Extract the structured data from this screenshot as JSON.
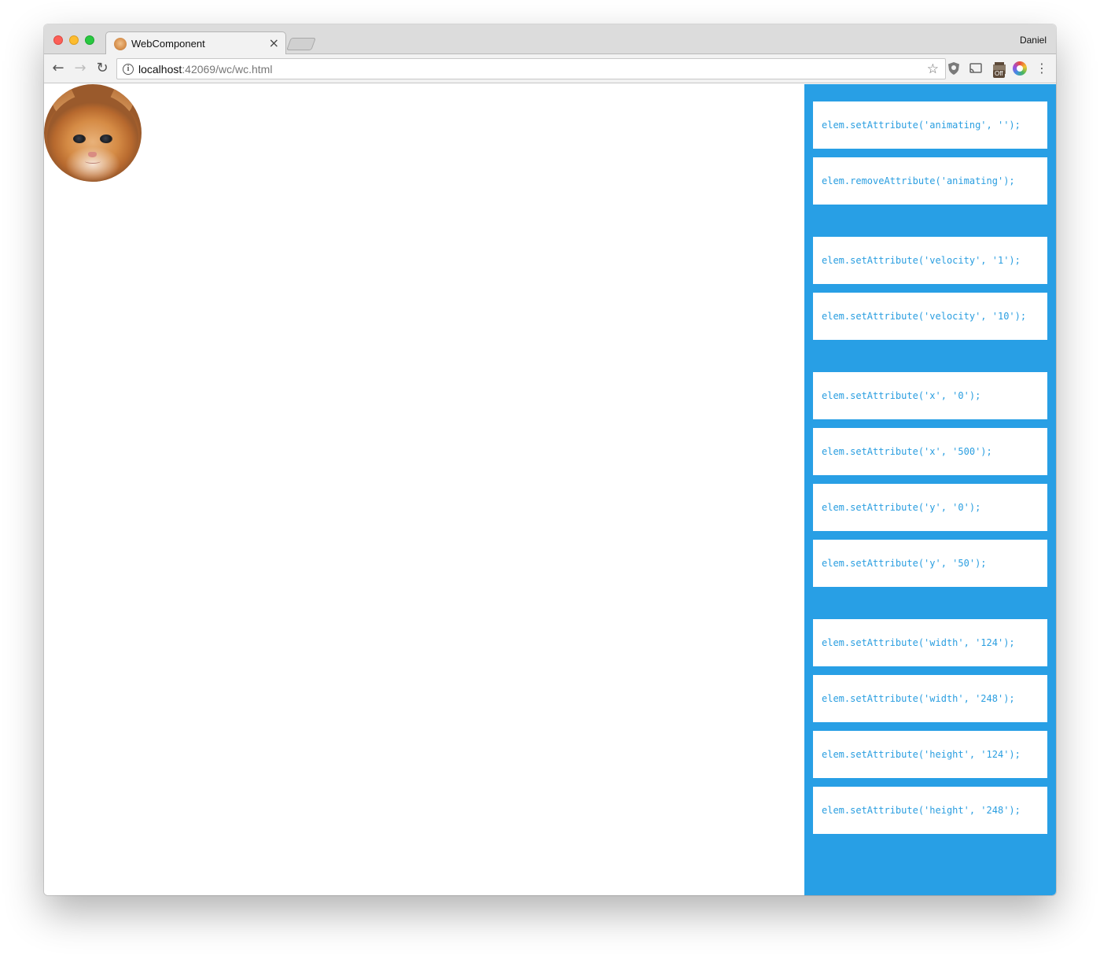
{
  "browser": {
    "tab_title": "WebComponent",
    "tab_close": "×",
    "profile_name": "Daniel",
    "url_host": "localhost",
    "url_rest": ":42069/wc/wc.html",
    "nav_back": "←",
    "nav_forward": "→",
    "nav_reload": "↻",
    "star": "☆",
    "info": "i",
    "off_badge": "Off",
    "menu": "⋮",
    "icons": [
      "back-arrow-icon",
      "forward-arrow-icon",
      "reload-icon",
      "info-icon",
      "star-icon",
      "shield-extension-icon",
      "cast-icon",
      "off-extension-icon",
      "color-extension-icon",
      "menu-icon"
    ]
  },
  "page": {
    "image": "kitten",
    "panel_color": "#289fe5",
    "commands": [
      "elem.setAttribute('animating', '');",
      "elem.removeAttribute('animating');",
      "elem.setAttribute('velocity', '1');",
      "elem.setAttribute('velocity', '10');",
      "elem.setAttribute('x', '0');",
      "elem.setAttribute('x', '500');",
      "elem.setAttribute('y', '0');",
      "elem.setAttribute('y', '50');",
      "elem.setAttribute('width', '124');",
      "elem.setAttribute('width', '248');",
      "elem.setAttribute('height', '124');",
      "elem.setAttribute('height', '248');"
    ]
  }
}
